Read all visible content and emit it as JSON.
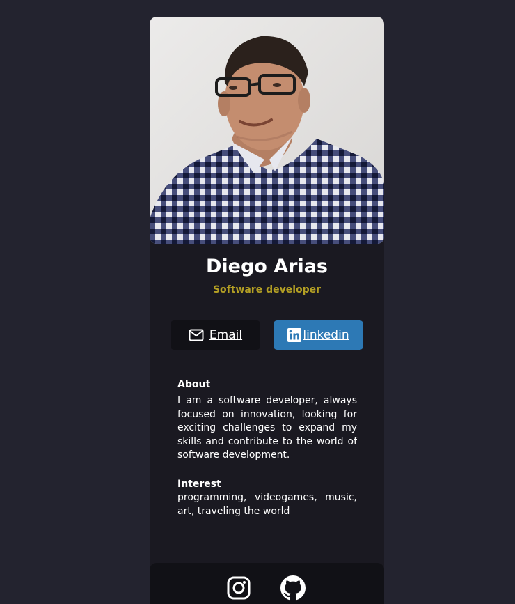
{
  "profile": {
    "name": "Diego Arias",
    "role": "Software developer"
  },
  "links": {
    "email_label": "Email",
    "linkedin_label": "linkedin",
    "email_icon": "envelope-icon",
    "linkedin_icon": "linkedin-icon"
  },
  "about": {
    "title": "About",
    "text": "I am a software developer, always focused on innovation, looking for exciting challenges to expand my skills and contribute to the world of software development."
  },
  "interest": {
    "title": "Interest",
    "text": "programming, videogames, music, art, traveling the world"
  },
  "footer": {
    "icons": [
      "instagram-icon",
      "github-icon"
    ]
  },
  "colors": {
    "background": "#23232f",
    "card": "#1a1921",
    "accent": "#b39f24",
    "linkedin": "#2d79b5",
    "dark_button": "#111116"
  }
}
